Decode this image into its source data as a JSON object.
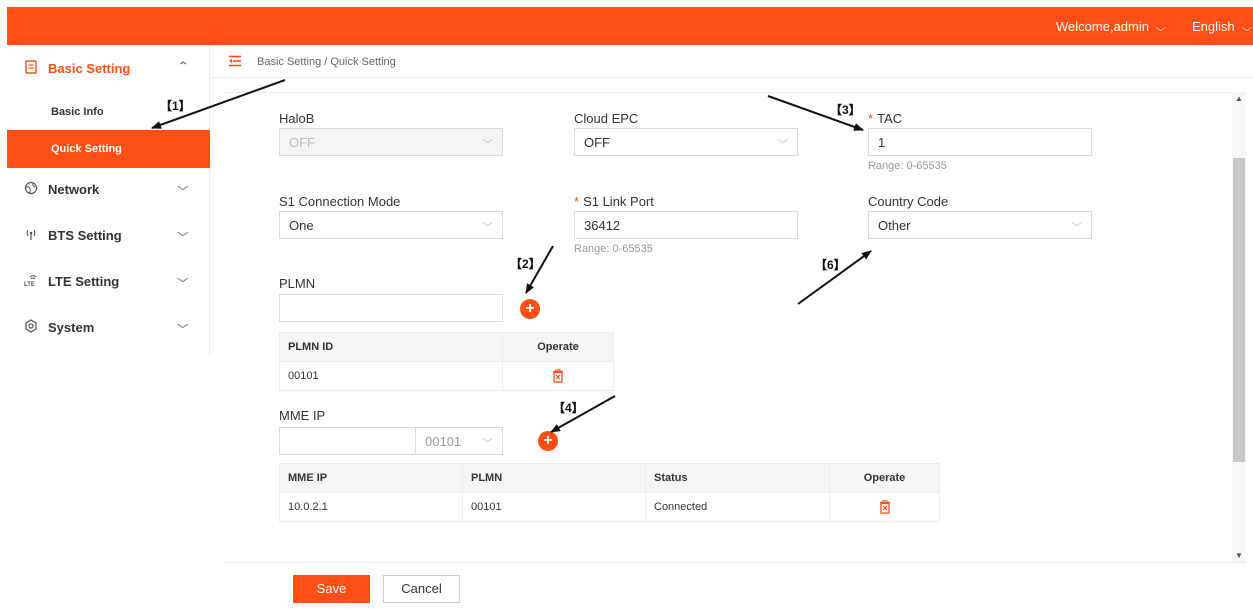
{
  "colors": {
    "accent": "#ff4f17"
  },
  "topbar": {
    "welcome": "Welcome,admin",
    "language": "English"
  },
  "sidebar": {
    "basic_setting": "Basic Setting",
    "basic_info": "Basic Info",
    "quick_setting": "Quick Setting",
    "network": "Network",
    "bts_setting": "BTS Setting",
    "lte_setting": "LTE Setting",
    "system": "System"
  },
  "breadcrumb": "Basic Setting / Quick Setting",
  "form": {
    "halob": {
      "label": "HaloB",
      "value": "OFF"
    },
    "cloud_epc": {
      "label": "Cloud EPC",
      "value": "OFF"
    },
    "tac": {
      "label": "TAC",
      "value": "1",
      "hint": "Range: 0-65535"
    },
    "s1_mode": {
      "label": "S1 Connection Mode",
      "value": "One"
    },
    "s1_port": {
      "label": "S1 Link Port",
      "value": "36412",
      "hint": "Range: 0-65535"
    },
    "country": {
      "label": "Country Code",
      "value": "Other"
    },
    "plmn": {
      "label": "PLMN",
      "value": ""
    },
    "mme_ip": {
      "label": "MME IP",
      "value": "",
      "plmn_select": "00101"
    }
  },
  "plmn_table": {
    "headers": [
      "PLMN ID",
      "Operate"
    ],
    "rows": [
      {
        "id": "00101"
      }
    ]
  },
  "mme_table": {
    "headers": [
      "MME IP",
      "PLMN",
      "Status",
      "Operate"
    ],
    "rows": [
      {
        "ip": "10.0.2.1",
        "plmn": "00101",
        "status": "Connected"
      }
    ]
  },
  "footer": {
    "save": "Save",
    "cancel": "Cancel"
  },
  "annotations": {
    "a1": "【1】",
    "a2": "【2】",
    "a3": "【3】",
    "a4": "【4】",
    "a6": "【6】"
  }
}
